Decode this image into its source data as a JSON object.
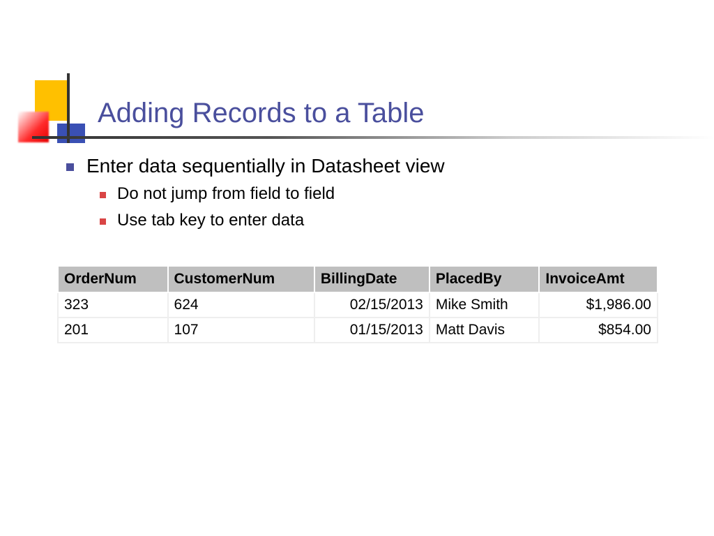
{
  "title": "Adding Records to a Table",
  "bullets": {
    "main": "Enter data sequentially in Datasheet view",
    "sub1": "Do not jump from field to field",
    "sub2": "Use tab key to enter data"
  },
  "table": {
    "headers": {
      "c0": "OrderNum",
      "c1": "CustomerNum",
      "c2": "BillingDate",
      "c3": "PlacedBy",
      "c4": "InvoiceAmt"
    },
    "rows": [
      {
        "c0": "323",
        "c1": "624",
        "c2": "02/15/2013",
        "c3": "Mike Smith",
        "c4": "$1,986.00"
      },
      {
        "c0": "201",
        "c1": "107",
        "c2": "01/15/2013",
        "c3": "Matt Davis",
        "c4": "$854.00"
      }
    ]
  }
}
